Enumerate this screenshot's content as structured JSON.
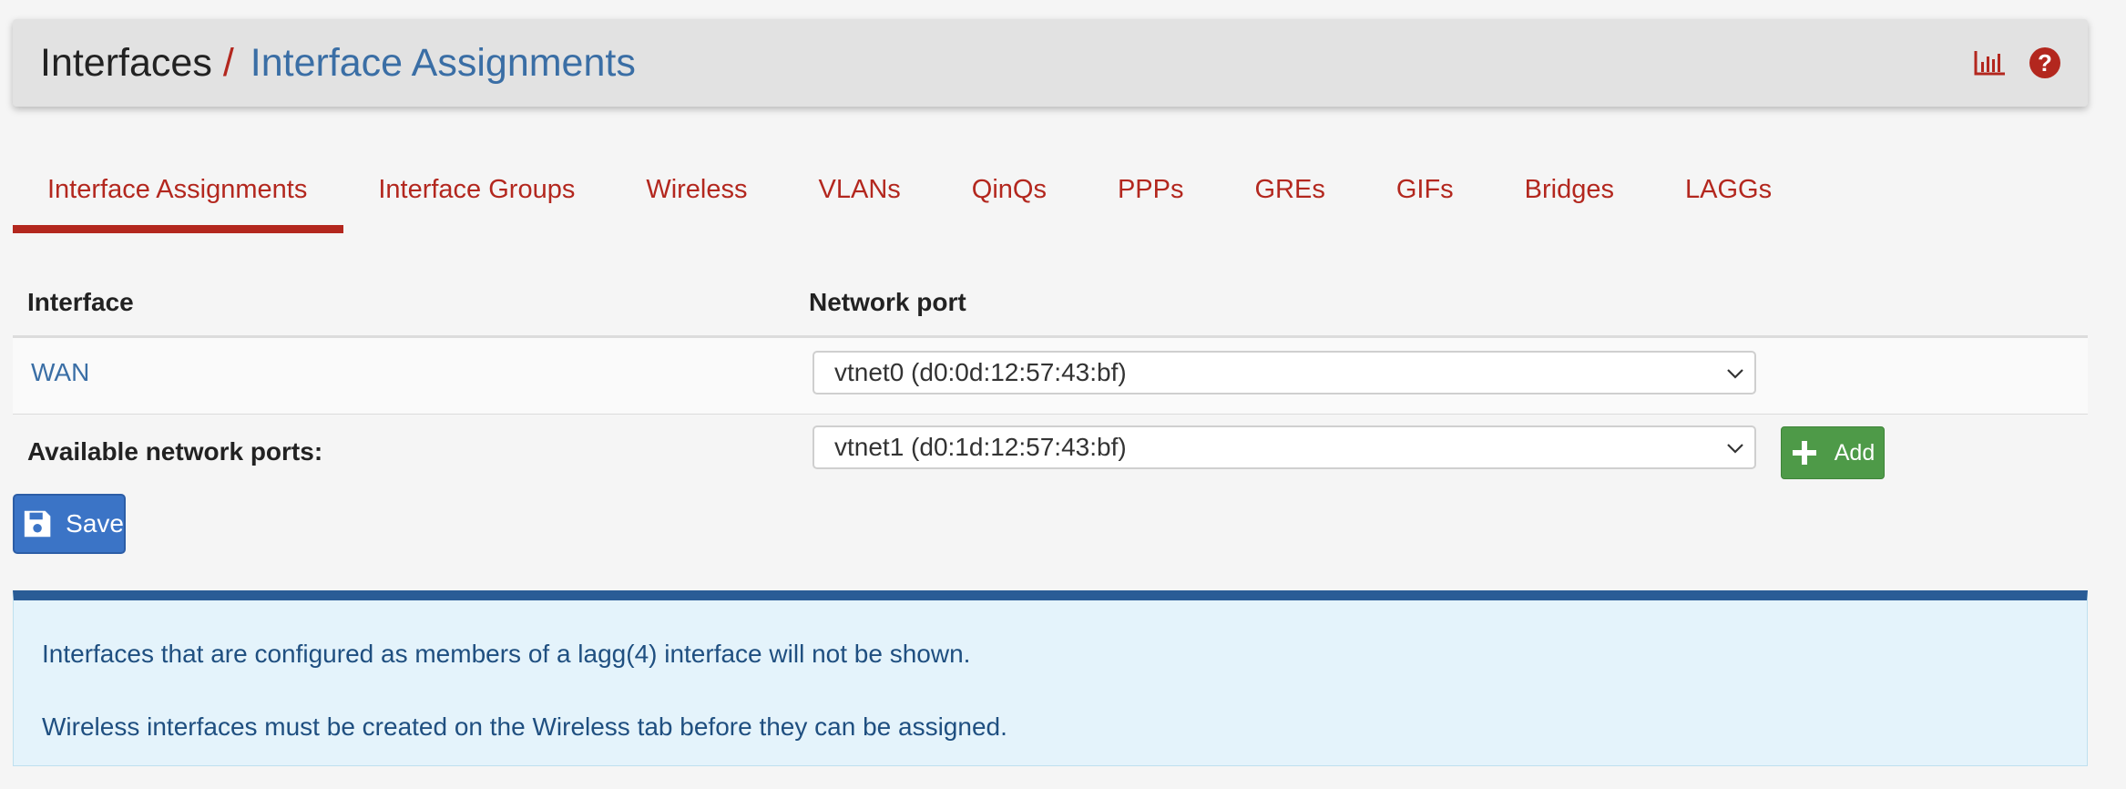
{
  "header": {
    "breadcrumb_root": "Interfaces",
    "breadcrumb_separator": "/",
    "breadcrumb_current": "Interface Assignments",
    "icons": [
      "bar-chart-icon",
      "help-icon"
    ]
  },
  "tabs": [
    {
      "label": "Interface Assignments",
      "active": true
    },
    {
      "label": "Interface Groups"
    },
    {
      "label": "Wireless"
    },
    {
      "label": "VLANs"
    },
    {
      "label": "QinQs"
    },
    {
      "label": "PPPs"
    },
    {
      "label": "GREs"
    },
    {
      "label": "GIFs"
    },
    {
      "label": "Bridges"
    },
    {
      "label": "LAGGs"
    }
  ],
  "table": {
    "headers": {
      "interface": "Interface",
      "network_port": "Network port"
    },
    "rows": [
      {
        "interface": "WAN",
        "network_port": "vtnet0 (d0:0d:12:57:43:bf)"
      }
    ],
    "available": {
      "label": "Available network ports:",
      "selected": "vtnet1 (d0:1d:12:57:43:bf)",
      "add_label": "Add"
    }
  },
  "save_label": "Save",
  "info": {
    "line1": "Interfaces that are configured as members of a lagg(4) interface will not be shown.",
    "line2": "Wireless interfaces must be created on the Wireless tab before they can be assigned."
  },
  "colors": {
    "accent_red": "#b3271e",
    "link_blue": "#3a6ea5",
    "add_green": "#4e9a48",
    "save_blue": "#3b74c6",
    "info_border": "#2a5c96",
    "info_bg": "#e4f3fb"
  }
}
